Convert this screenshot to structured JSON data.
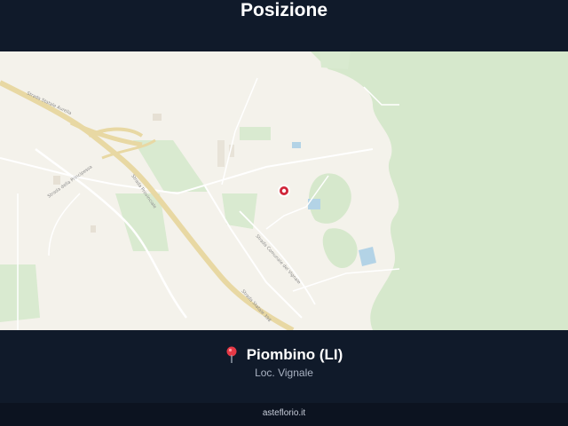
{
  "header": {
    "title": "Posizione"
  },
  "map": {
    "roads": {
      "road_1": "Strada Statale Aurelia",
      "road_2": "Strada della Principessa",
      "road_3": "Strada Provinciale",
      "road_4": "Strada Comunale del Vignale",
      "road_5": "Strada Statale 398"
    },
    "marker": {
      "icon": "location-marker-icon",
      "color": "#d0263a"
    },
    "colors": {
      "land": "#f4f2eb",
      "forest": "#d4e6c9",
      "field": "#dcebd2",
      "water": "#aacde4",
      "highway": "#ead9a4"
    }
  },
  "location": {
    "pin_icon": "map-pin-icon",
    "name": "Piombino (LI)",
    "subtitle": "Loc. Vignale"
  },
  "footer": {
    "site": "asteflorio.it"
  }
}
